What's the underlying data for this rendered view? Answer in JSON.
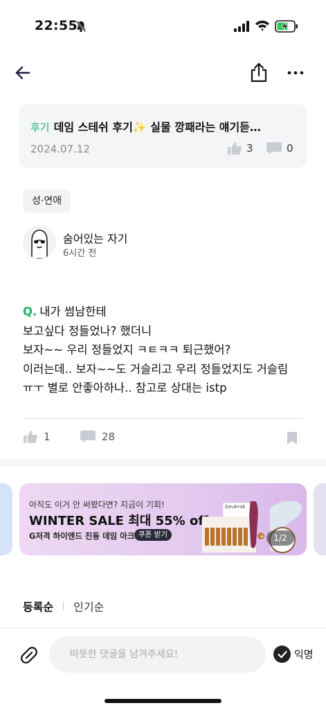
{
  "status_bar": {
    "time": "22:55"
  },
  "related_post": {
    "tag": "후기",
    "title": "데임 스테쉬 후기✨ 실물 깡패라는 얘기듣…",
    "date": "2024.07.12",
    "likes": "3",
    "comments": "0"
  },
  "category": "성·연애",
  "author": {
    "name": "숨어있는 자기",
    "time": "6시간 전"
  },
  "post": {
    "q_mark": "Q.",
    "lines": [
      "내가 썸남한테",
      "보고싶다 정들었나? 했더니",
      "보자~~ 우리 정들었지 ㅋㅌㅋㅋ 퇴근했어?",
      "이러는데.. 보자~~도 거슬리고 우리 정들었지도 거슬림",
      "ㅠㅜ 별로 안좋아하나.. 참고로 상대는 istp"
    ],
    "likes": "1",
    "comments": "28"
  },
  "banner": {
    "subtitle": "아직도 이거 안 써봤다면? 지금이 기회!",
    "headline": "WINTER SALE 최대 55% off",
    "desc": "G저격 하이엔드 진동 데임 아크",
    "coupon": "쿠폰 받기",
    "brand": "Geukrak",
    "counter": "1/2"
  },
  "sort": {
    "active": "등록순",
    "inactive": "인기순"
  },
  "comment_input": {
    "placeholder": "따뜻한 댓글을 남겨주세요!"
  },
  "anonymous_label": "익명",
  "colors": {
    "accent_green": "#1fb36a"
  }
}
